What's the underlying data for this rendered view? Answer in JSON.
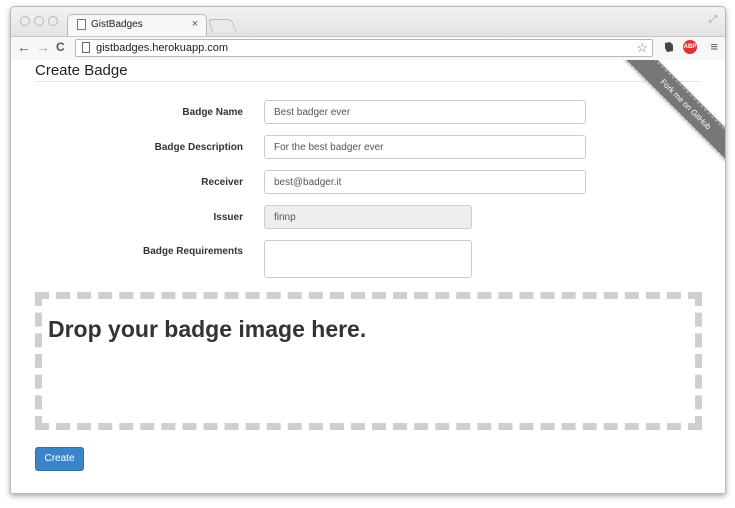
{
  "browser": {
    "tab_title": "GistBadges",
    "tab_close": "×",
    "url": "gistbadges.herokuapp.com",
    "back_glyph": "←",
    "forward_glyph": "→",
    "reload_glyph": "C",
    "star_glyph": "☆",
    "menu_glyph": "≡",
    "abp_label": "ABP"
  },
  "page": {
    "title": "Create Badge",
    "ribbon": "Fork me on GitHub"
  },
  "form": {
    "badge_name": {
      "label": "Badge Name",
      "value": "Best badger ever"
    },
    "badge_description": {
      "label": "Badge Description",
      "value": "For the best badger ever"
    },
    "receiver": {
      "label": "Receiver",
      "value": "best@badger.it"
    },
    "issuer": {
      "label": "Issuer",
      "value": "finnp"
    },
    "badge_requirements": {
      "label": "Badge Requirements",
      "value": ""
    }
  },
  "dropzone": {
    "text": "Drop your badge image here."
  },
  "create_button": "Create",
  "colors": {
    "primary": "#3c84c8",
    "ribbon": "#777777",
    "abp": "#dd3333"
  }
}
